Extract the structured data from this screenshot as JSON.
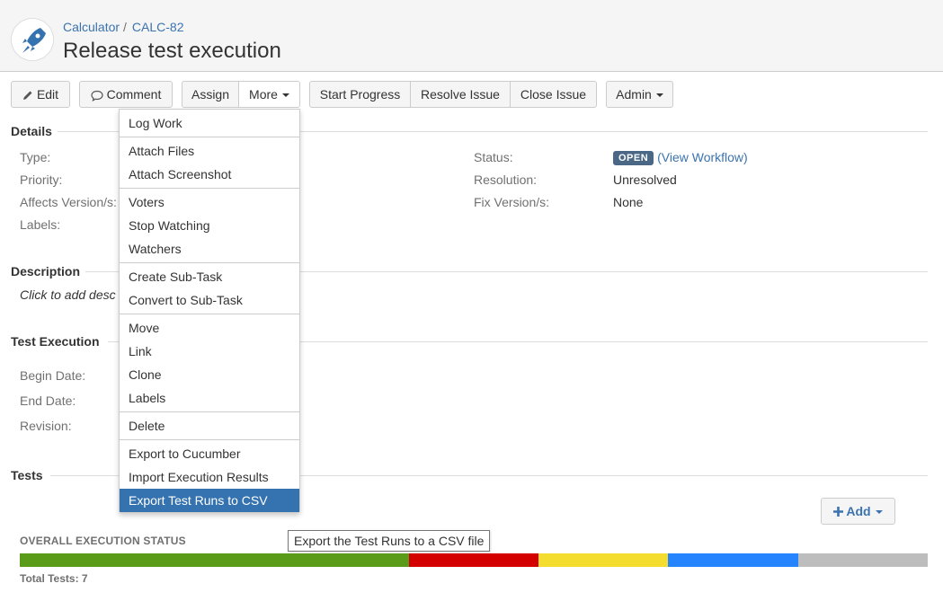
{
  "breadcrumb": {
    "project": "Calculator",
    "separator": "/",
    "issue_key": "CALC-82"
  },
  "page_title": "Release test execution",
  "toolbar": {
    "edit": "Edit",
    "comment": "Comment",
    "assign": "Assign",
    "more": "More",
    "start_progress": "Start Progress",
    "resolve_issue": "Resolve Issue",
    "close_issue": "Close Issue",
    "admin": "Admin"
  },
  "details": {
    "heading": "Details",
    "left": [
      "Type:",
      "Priority:",
      "Affects Version/s:",
      "Labels:"
    ],
    "right_labels": [
      "Status:",
      "Resolution:",
      "Fix Version/s:"
    ],
    "status_badge": "OPEN",
    "view_workflow_open": "(",
    "view_workflow": "View Workflow",
    "view_workflow_close": ")",
    "resolution": "Unresolved",
    "fix_versions": "None"
  },
  "description": {
    "heading": "Description",
    "placeholder": "Click to add desc"
  },
  "test_execution": {
    "heading": "Test Execution",
    "labels": [
      "Begin Date:",
      "End Date:",
      "Revision:"
    ]
  },
  "tests": {
    "heading": "Tests",
    "add_label": "Add",
    "overall_title": "OVERALL EXECUTION STATUS",
    "total": "Total Tests: 7",
    "progress": [
      {
        "status": "passed",
        "fraction": 0.4286,
        "color": "#5b9b1a"
      },
      {
        "status": "failed",
        "fraction": 0.1429,
        "color": "#d40000"
      },
      {
        "status": "executing",
        "fraction": 0.1429,
        "color": "#f5dd2f"
      },
      {
        "status": "todo",
        "fraction": 0.1429,
        "color": "#2684ff"
      },
      {
        "status": "aborted",
        "fraction": 0.1429,
        "color": "#bdbdbd"
      }
    ]
  },
  "more_menu": {
    "items": [
      "Log Work",
      "Attach Files",
      "Attach Screenshot",
      "Voters",
      "Stop Watching",
      "Watchers",
      "Create Sub-Task",
      "Convert to Sub-Task",
      "Move",
      "Link",
      "Clone",
      "Labels",
      "Delete",
      "Export to Cucumber",
      "Import Execution Results",
      "Export Test Runs to CSV"
    ],
    "active_index": 15
  },
  "tooltip": "Export the Test Runs to a CSV file",
  "colors": {
    "accent": "#3b73af",
    "menu_active": "#3572b0",
    "lozenge": "#4a6785"
  },
  "icons": {
    "avatar": "rocket-icon",
    "edit": "pencil-icon",
    "comment": "speech-bubble-icon",
    "add": "plus-icon"
  }
}
